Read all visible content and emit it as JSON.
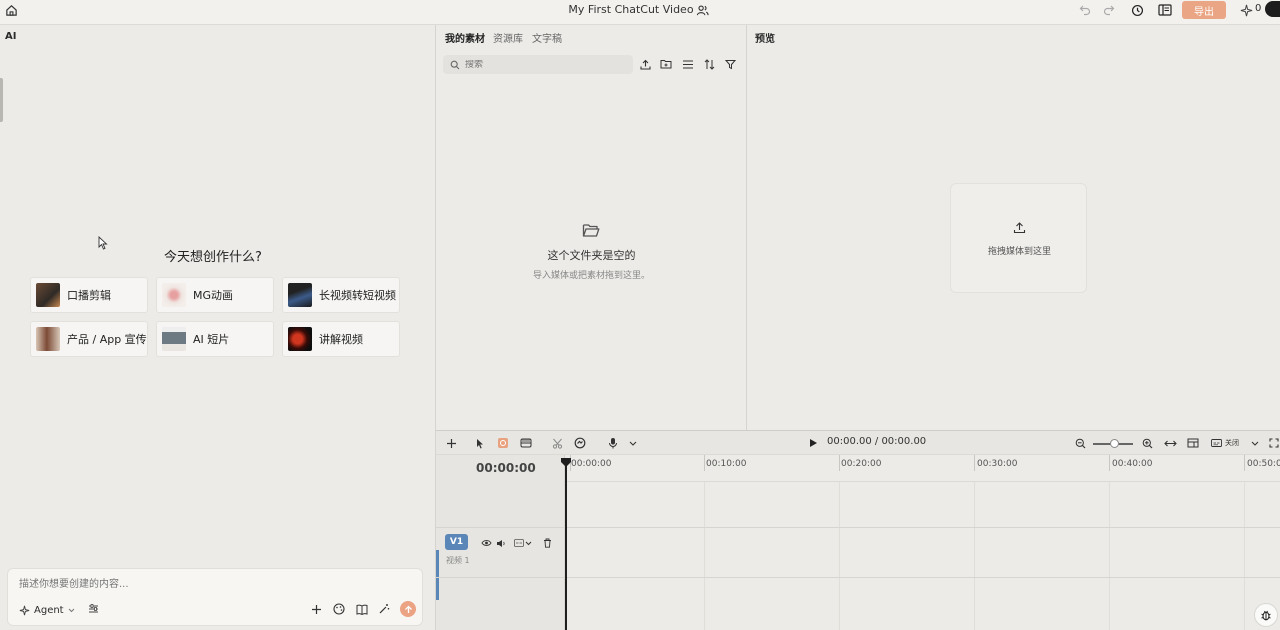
{
  "topbar": {
    "project_title": "My First ChatCut Video",
    "export_label": "导出",
    "credits": "0"
  },
  "ai_panel": {
    "title": "AI",
    "heading": "今天想创作什么?",
    "cards": [
      {
        "label": "口播剪辑"
      },
      {
        "label": "MG动画"
      },
      {
        "label": "长视频转短视频"
      },
      {
        "label": "产品 / App 宣传"
      },
      {
        "label": "AI 短片"
      },
      {
        "label": "讲解视频"
      }
    ],
    "input_placeholder": "描述你想要创建的内容...",
    "agent_label": "Agent"
  },
  "media_panel": {
    "tabs": [
      "我的素材",
      "资源库",
      "文字稿"
    ],
    "search_placeholder": "搜索",
    "empty_title": "这个文件夹是空的",
    "empty_hint": "导入媒体或把素材拖到这里。"
  },
  "preview_panel": {
    "title": "预览",
    "drop_text": "拖拽媒体到这里"
  },
  "timeline": {
    "timecode": "00:00.00 / 00:00.00",
    "playhead_time": "00:00:00",
    "ruler": [
      "00:00:00",
      "00:10:00",
      "00:20:00",
      "00:30:00",
      "00:40:00",
      "00:50:0"
    ],
    "caption_toggle": "关闭",
    "track": {
      "badge": "V1",
      "name": "视频 1"
    }
  },
  "colors": {
    "accent": "#eaa585",
    "track_badge": "#5b86b8",
    "send_button": "#eba384"
  }
}
